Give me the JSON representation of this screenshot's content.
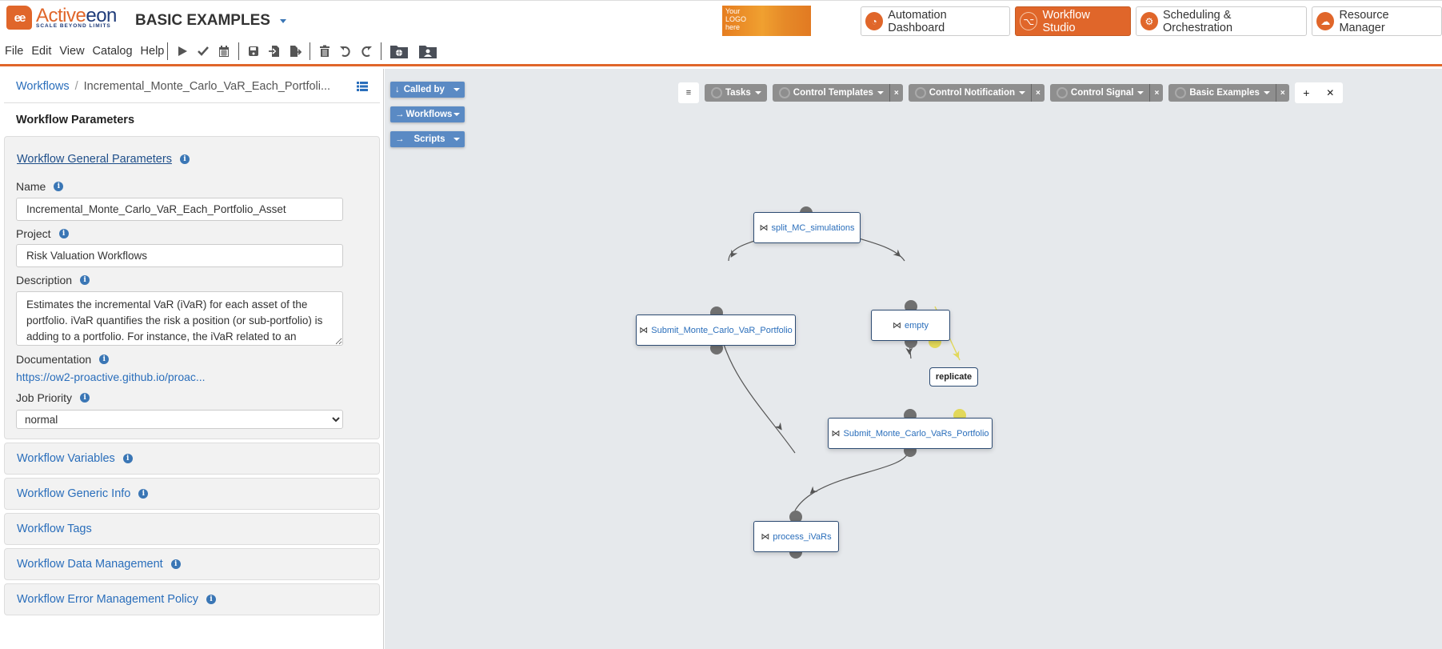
{
  "header": {
    "logo_brand_prefix": "Active",
    "logo_brand_suffix": "eon",
    "logo_tagline": "SCALE BEYOND LIMITS",
    "catalog_title": "BASIC EXAMPLES",
    "your_logo_text": [
      "Your",
      "LOGO",
      "here"
    ],
    "portals": [
      {
        "label": "Automation Dashboard",
        "icon": "gauge-icon",
        "active": false
      },
      {
        "label": "Workflow Studio",
        "icon": "workflow-icon",
        "active": true
      },
      {
        "label": "Scheduling & Orchestration",
        "icon": "gears-icon",
        "active": false
      },
      {
        "label": "Resource Manager",
        "icon": "cloud-icon",
        "active": false
      }
    ]
  },
  "menubar": {
    "menus": [
      "File",
      "Edit",
      "View",
      "Catalog",
      "Help"
    ],
    "tools": [
      "play-icon",
      "check-icon",
      "calendar-icon",
      "save-icon",
      "import-icon",
      "export-icon",
      "trash-icon",
      "undo-icon",
      "redo-icon",
      "folder-globe-icon",
      "folder-user-icon"
    ]
  },
  "left_panel": {
    "breadcrumb": {
      "root": "Workflows",
      "current": "Incremental_Monte_Carlo_VaR_Each_Portfoli..."
    },
    "title": "Workflow Parameters",
    "general": {
      "heading": "Workflow General Parameters",
      "name_label": "Name",
      "name_value": "Incremental_Monte_Carlo_VaR_Each_Portfolio_Asset",
      "project_label": "Project",
      "project_value": "Risk Valuation Workflows",
      "description_label": "Description",
      "description_value": "Estimates the incremental VaR (iVaR) for each asset of the portfolio. iVaR quantifies the risk a position (or sub-portfolio) is adding to a portfolio. For instance, the iVaR related to an",
      "documentation_label": "Documentation",
      "documentation_link": "https://ow2-proactive.github.io/proac...",
      "priority_label": "Job Priority",
      "priority_value": "normal"
    },
    "sections": [
      {
        "label": "Workflow Variables",
        "info": true
      },
      {
        "label": "Workflow Generic Info",
        "info": true
      },
      {
        "label": "Workflow Tags",
        "info": false
      },
      {
        "label": "Workflow Data Management",
        "info": true
      },
      {
        "label": "Workflow Error Management Policy",
        "info": true
      }
    ]
  },
  "canvas": {
    "side_dropdowns": [
      {
        "label": "Called by",
        "icon": "arrow-down-icon"
      },
      {
        "label": "Workflows",
        "icon": "arrow-right-icon"
      },
      {
        "label": "Scripts",
        "icon": "arrow-right-icon"
      }
    ],
    "palette": {
      "groups": [
        {
          "label": "Tasks",
          "closable": false
        },
        {
          "label": "Control Templates",
          "closable": true
        },
        {
          "label": "Control Notification",
          "closable": true
        },
        {
          "label": "Control Signal",
          "closable": true
        },
        {
          "label": "Basic Examples",
          "closable": true
        }
      ],
      "close_glyph": "×",
      "add_glyph": "+",
      "pin_glyph": "✕"
    },
    "tasks": [
      {
        "id": "split",
        "label": "split_MC_simulations"
      },
      {
        "id": "submit_var",
        "label": "Submit_Monte_Carlo_VaR_Portfolio"
      },
      {
        "id": "empty",
        "label": "empty"
      },
      {
        "id": "submit_vars",
        "label": "Submit_Monte_Carlo_VaRs_Portfolio"
      },
      {
        "id": "process",
        "label": "process_iVaRs"
      }
    ],
    "replicate_label": "replicate",
    "colors": {
      "edge": "#555555",
      "replicate": "#e2d85a",
      "node_border": "#2d4b72"
    }
  }
}
